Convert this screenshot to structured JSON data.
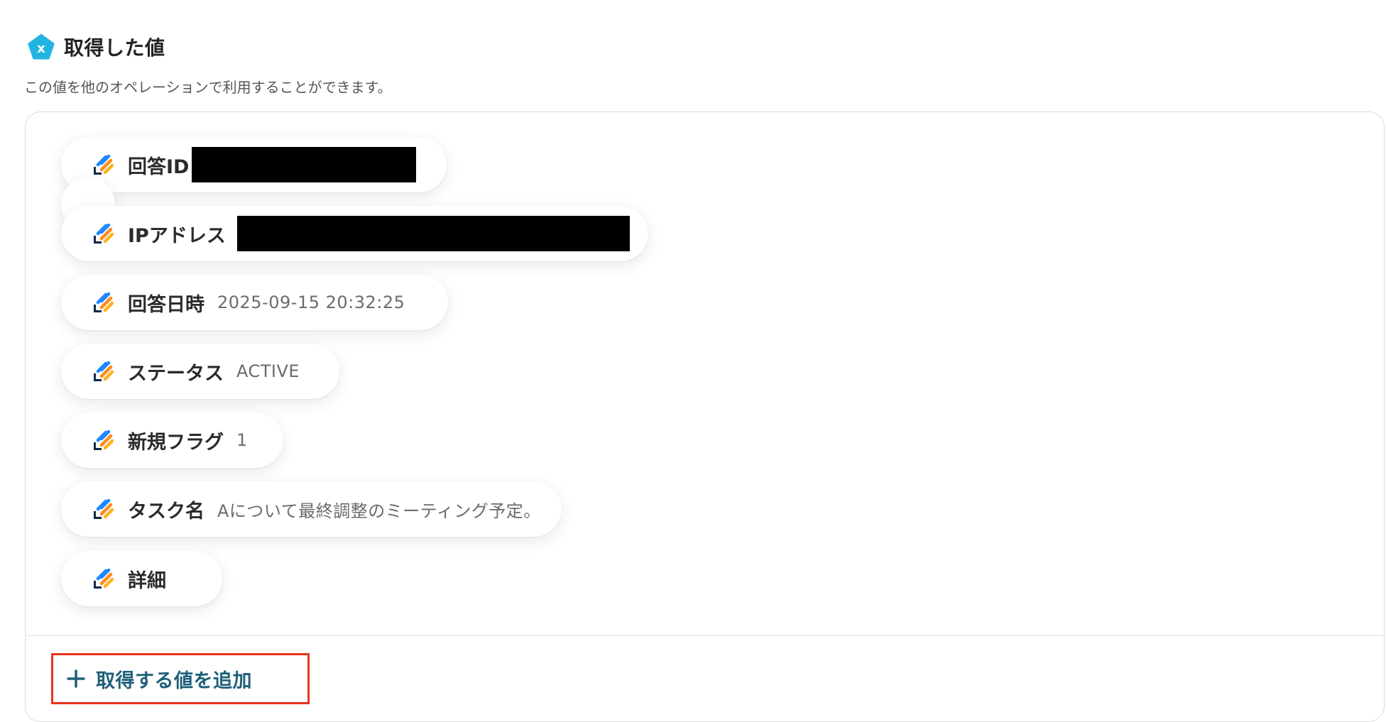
{
  "section": {
    "icon": "pentagon-x-icon",
    "icon_letter": "x",
    "title": "取得した値",
    "description": "この値を他のオペレーションで利用することができます。"
  },
  "values": [
    {
      "label": "回答ID",
      "value": "",
      "redacted": true
    },
    {
      "label": "IPアドレス",
      "value": "",
      "redacted": true
    },
    {
      "label": "回答日時",
      "value": "2025-09-15 20:32:25",
      "redacted": false
    },
    {
      "label": "ステータス",
      "value": "ACTIVE",
      "redacted": false
    },
    {
      "label": "新規フラグ",
      "value": "1",
      "redacted": false
    },
    {
      "label": "タスク名",
      "value": "Aについて最終調整のミーティング予定。",
      "redacted": false
    },
    {
      "label": "詳細",
      "value": "",
      "redacted": false
    }
  ],
  "chip_icon": "app-stripes-icon",
  "add_button": {
    "icon": "plus-icon",
    "label": "取得する値を追加"
  },
  "colors": {
    "header_icon": "#21b3e2",
    "add_text": "#1f5f78",
    "highlight_border": "#e8341c",
    "chip_icon_blue": "#1e88ff",
    "chip_icon_orange": "#ff8a1f",
    "chip_icon_navy": "#0d2a4a"
  }
}
